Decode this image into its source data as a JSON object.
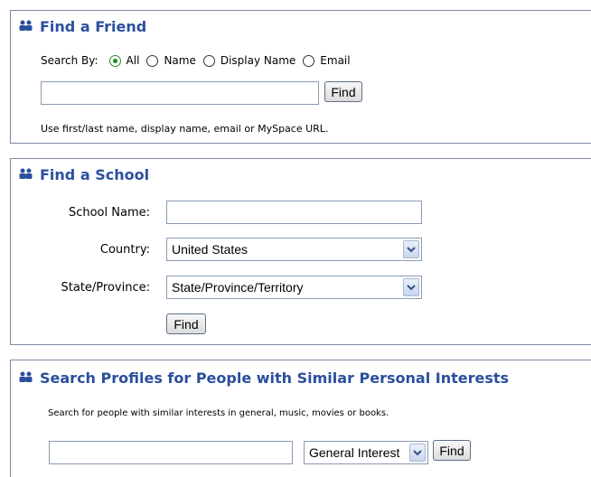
{
  "find_friend": {
    "title": "Find a Friend",
    "search_by_label": "Search By:",
    "options": [
      "All",
      "Name",
      "Display Name",
      "Email"
    ],
    "selected": "All",
    "input_value": "",
    "find_label": "Find",
    "hint": "Use first/last name, display name, email or MySpace URL."
  },
  "find_school": {
    "title": "Find a School",
    "school_name_label": "School Name:",
    "school_name_value": "",
    "country_label": "Country:",
    "country_value": "United States",
    "state_label": "State/Province:",
    "state_value": "State/Province/Territory",
    "find_label": "Find"
  },
  "search_interests": {
    "title": "Search Profiles for People with Similar Personal Interests",
    "hint": "Search for people with similar interests in general, music, movies or books.",
    "input_value": "",
    "category_value": "General Interest",
    "find_label": "Find"
  },
  "colors": {
    "title": "#2b4f9e",
    "border": "#7d8ba6",
    "radio_selected": "#1a8a1a"
  },
  "icons": [
    "people-group-icon",
    "chevron-down-icon"
  ]
}
